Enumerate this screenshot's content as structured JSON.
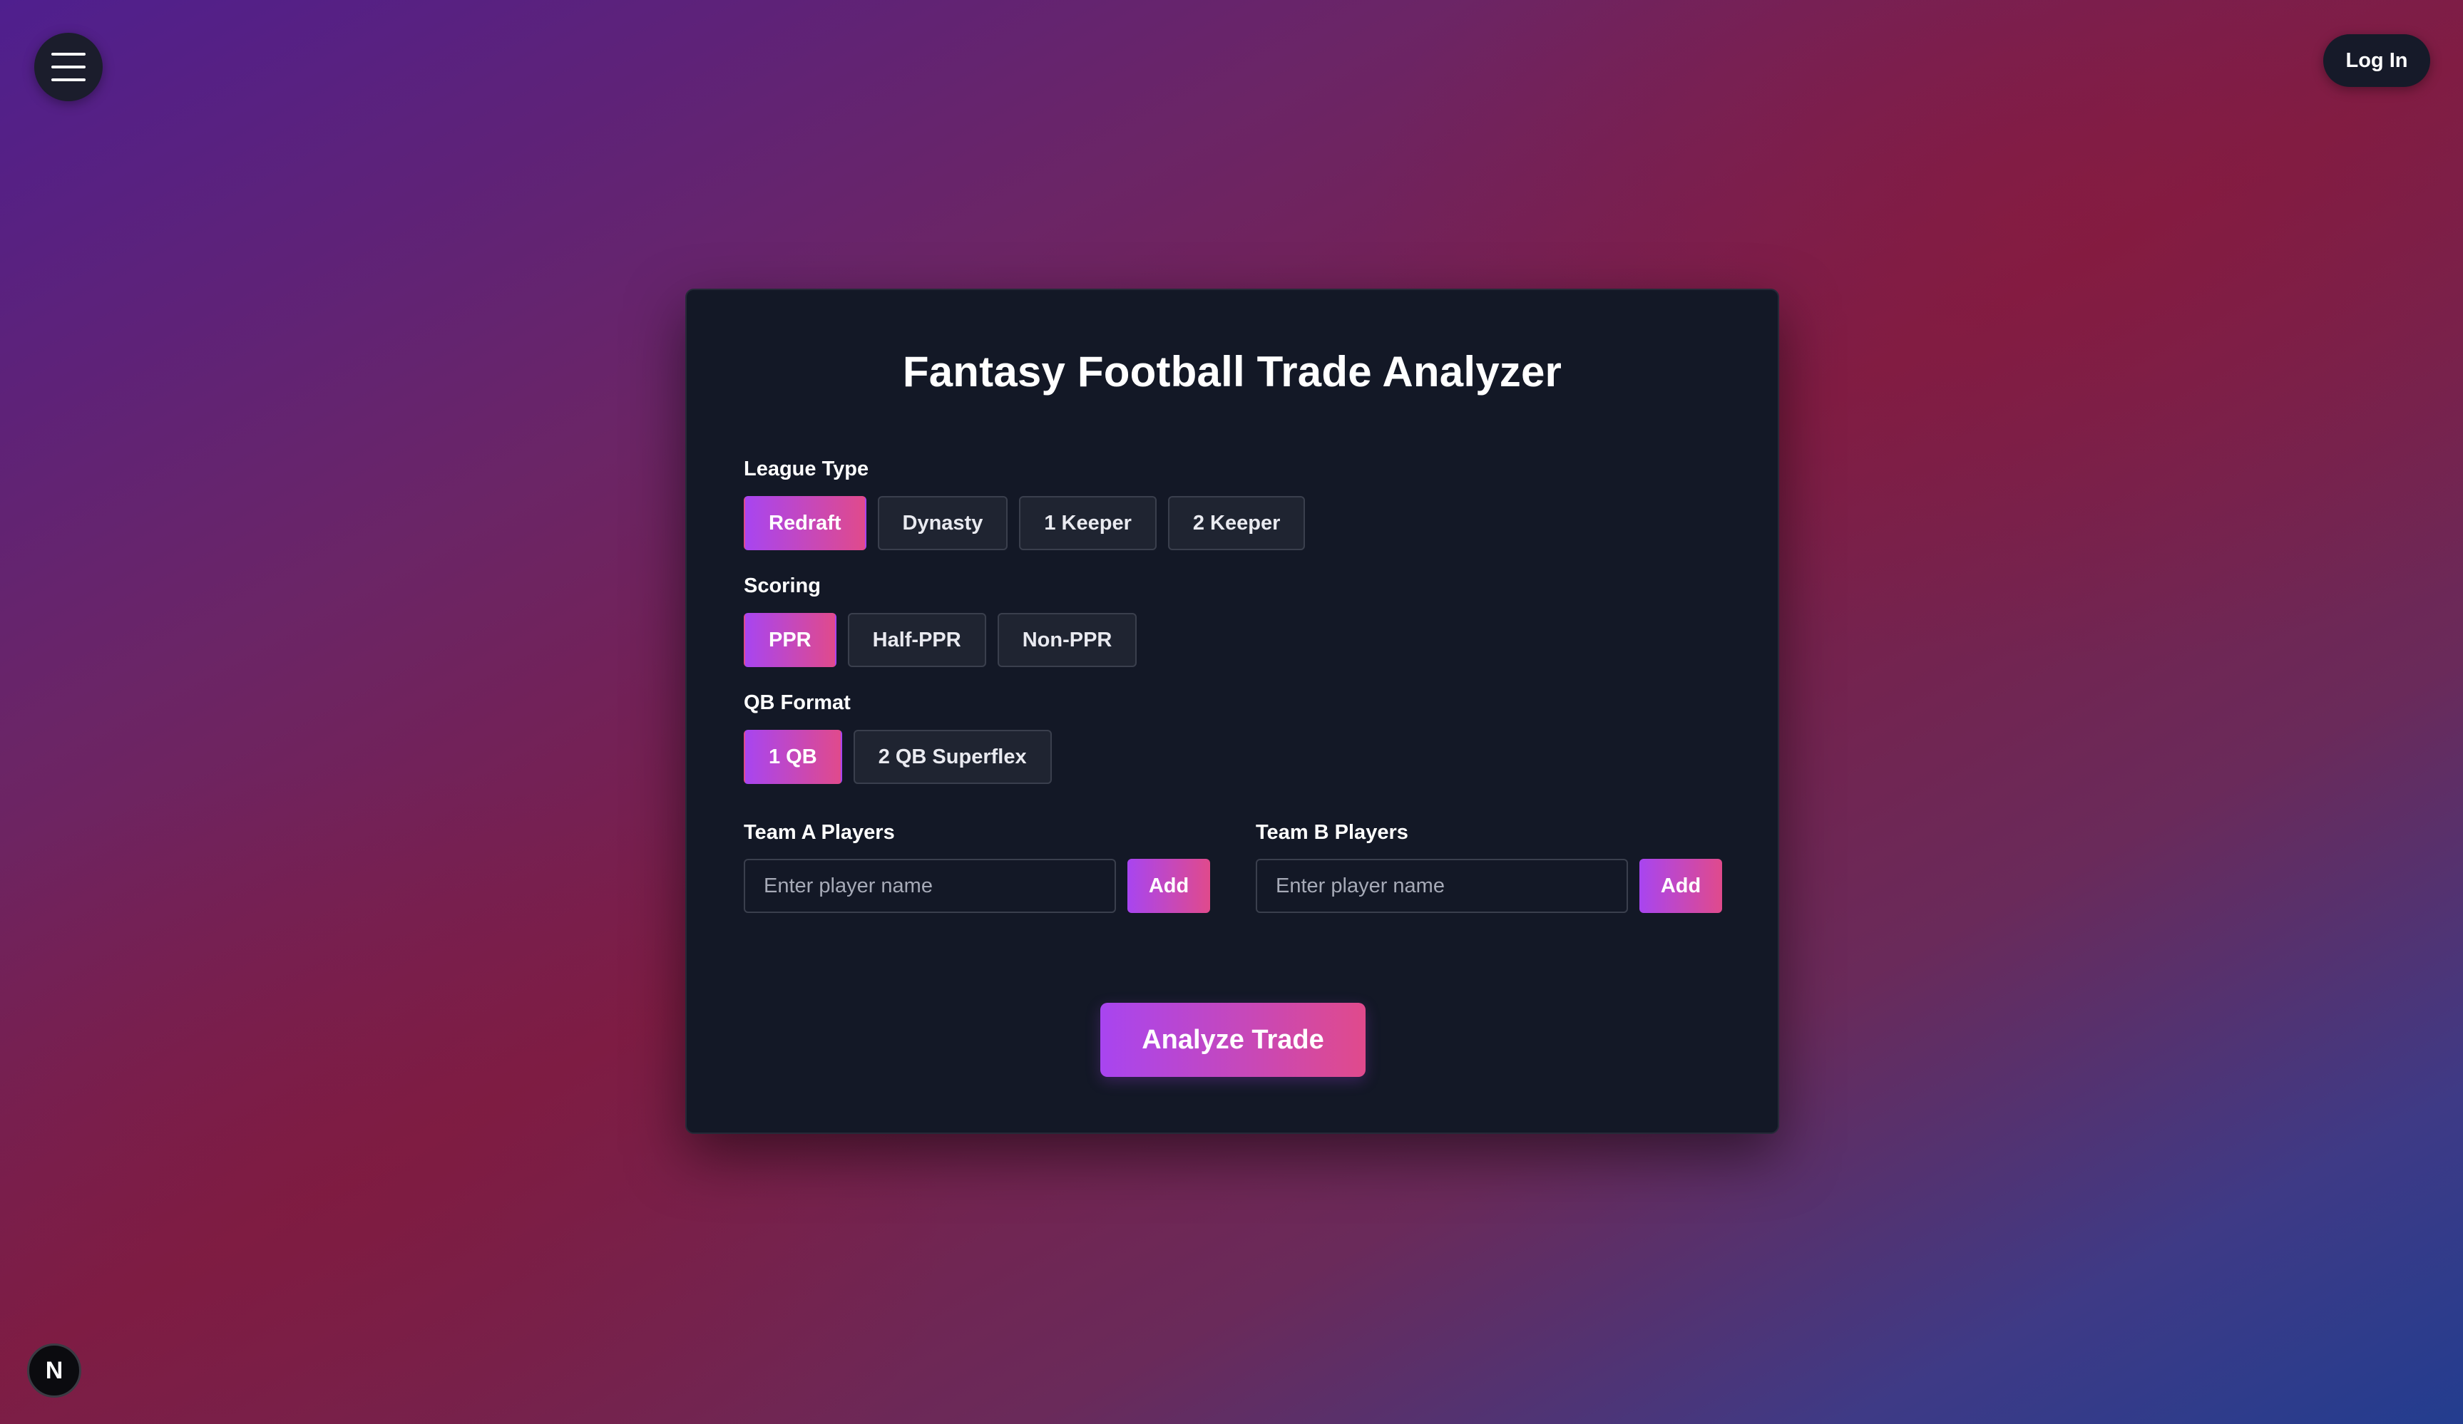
{
  "header": {
    "menu_icon": "hamburger-icon",
    "login_label": "Log In"
  },
  "badge": {
    "letter": "N"
  },
  "card": {
    "title": "Fantasy Football Trade Analyzer",
    "league_type": {
      "label": "League Type",
      "options": [
        "Redraft",
        "Dynasty",
        "1 Keeper",
        "2 Keeper"
      ],
      "selected": "Redraft"
    },
    "scoring": {
      "label": "Scoring",
      "options": [
        "PPR",
        "Half-PPR",
        "Non-PPR"
      ],
      "selected": "PPR"
    },
    "qb_format": {
      "label": "QB Format",
      "options": [
        "1 QB",
        "2 QB Superflex"
      ],
      "selected": "1 QB"
    },
    "team_a": {
      "label": "Team A Players",
      "placeholder": "Enter player name",
      "value": "",
      "add_label": "Add"
    },
    "team_b": {
      "label": "Team B Players",
      "placeholder": "Enter player name",
      "value": "",
      "add_label": "Add"
    },
    "analyze_label": "Analyze Trade"
  },
  "colors": {
    "accent_start": "#a845f0",
    "accent_end": "#e04a8c",
    "card_bg": "#131826"
  }
}
